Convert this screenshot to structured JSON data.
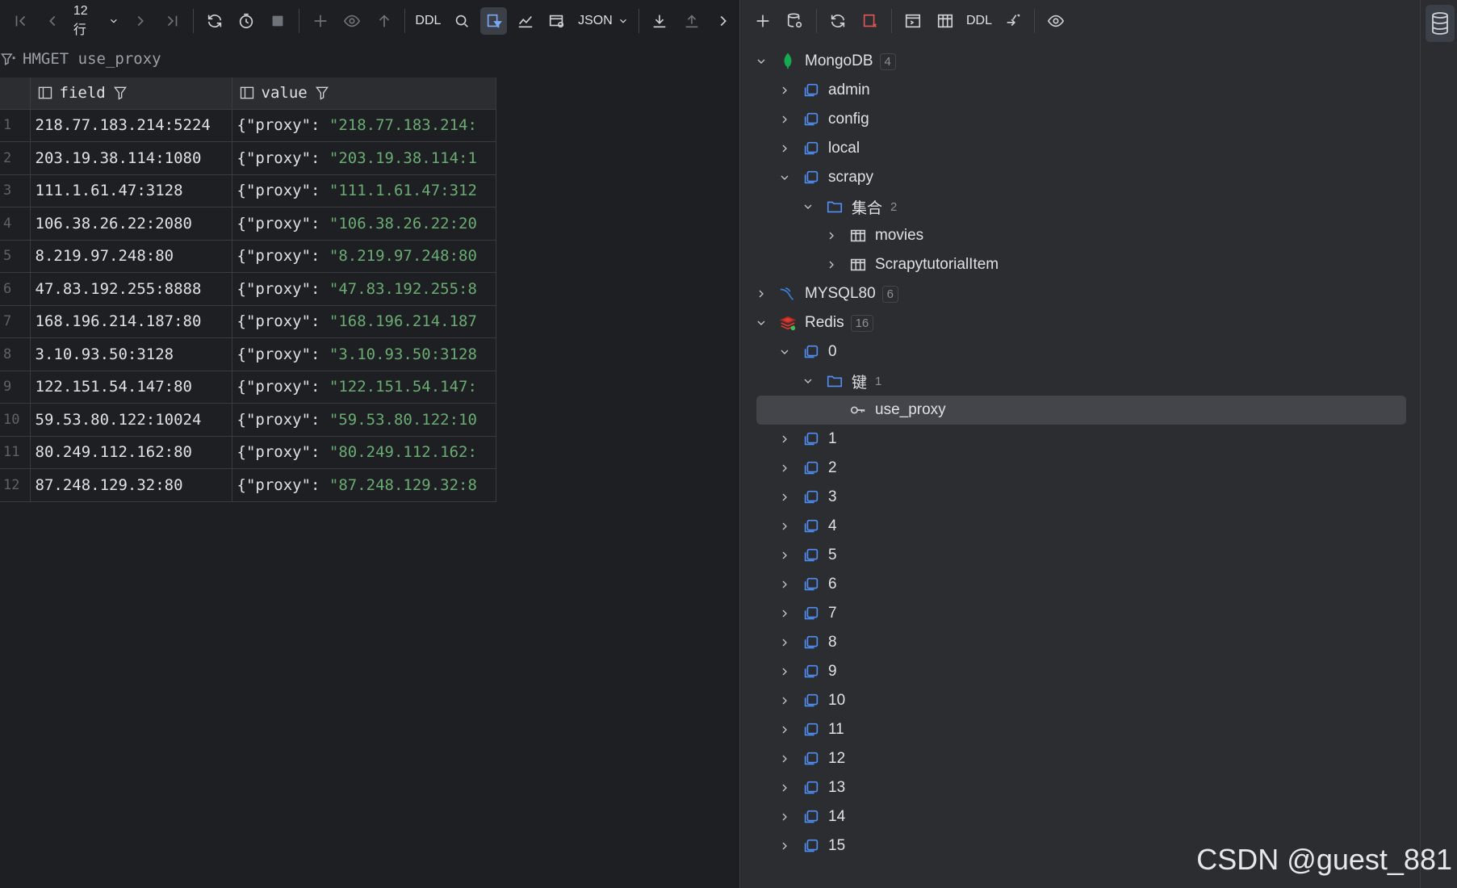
{
  "toolbar_left": {
    "rows_label": "12 行",
    "ddl_label": "DDL",
    "format_label": "JSON"
  },
  "toolbar_right": {
    "ddl_label": "DDL"
  },
  "query": {
    "text": "HMGET use_proxy"
  },
  "grid": {
    "headers": {
      "field": "field",
      "value": "value"
    },
    "rows": [
      {
        "n": "1",
        "field": "218.77.183.214:5224",
        "vkey": "{\"proxy\": ",
        "vstr": "\"218.77.183.214:"
      },
      {
        "n": "2",
        "field": "203.19.38.114:1080",
        "vkey": "{\"proxy\": ",
        "vstr": "\"203.19.38.114:1"
      },
      {
        "n": "3",
        "field": "111.1.61.47:3128",
        "vkey": "{\"proxy\": ",
        "vstr": "\"111.1.61.47:312"
      },
      {
        "n": "4",
        "field": "106.38.26.22:2080",
        "vkey": "{\"proxy\": ",
        "vstr": "\"106.38.26.22:20"
      },
      {
        "n": "5",
        "field": "8.219.97.248:80",
        "vkey": "{\"proxy\": ",
        "vstr": "\"8.219.97.248:80"
      },
      {
        "n": "6",
        "field": "47.83.192.255:8888",
        "vkey": "{\"proxy\": ",
        "vstr": "\"47.83.192.255:8"
      },
      {
        "n": "7",
        "field": "168.196.214.187:80",
        "vkey": "{\"proxy\": ",
        "vstr": "\"168.196.214.187"
      },
      {
        "n": "8",
        "field": "3.10.93.50:3128",
        "vkey": "{\"proxy\": ",
        "vstr": "\"3.10.93.50:3128"
      },
      {
        "n": "9",
        "field": "122.151.54.147:80",
        "vkey": "{\"proxy\": ",
        "vstr": "\"122.151.54.147:"
      },
      {
        "n": "10",
        "field": "59.53.80.122:10024",
        "vkey": "{\"proxy\": ",
        "vstr": "\"59.53.80.122:10"
      },
      {
        "n": "11",
        "field": "80.249.112.162:80",
        "vkey": "{\"proxy\": ",
        "vstr": "\"80.249.112.162:"
      },
      {
        "n": "12",
        "field": "87.248.129.32:80",
        "vkey": "{\"proxy\": ",
        "vstr": "\"87.248.129.32:8"
      }
    ]
  },
  "tree": [
    {
      "label": "MongoDB",
      "badge": "4",
      "level": 0,
      "expanded": true,
      "icon": "mongodb-icon"
    },
    {
      "label": "admin",
      "level": 1,
      "expanded": false,
      "icon": "database-icon"
    },
    {
      "label": "config",
      "level": 1,
      "expanded": false,
      "icon": "database-icon"
    },
    {
      "label": "local",
      "level": 1,
      "expanded": false,
      "icon": "database-icon"
    },
    {
      "label": "scrapy",
      "level": 1,
      "expanded": true,
      "icon": "database-icon"
    },
    {
      "label": "集合",
      "count": "2",
      "level": 2,
      "expanded": true,
      "icon": "folder-icon"
    },
    {
      "label": "movies",
      "level": 3,
      "expanded": false,
      "icon": "table-icon"
    },
    {
      "label": "ScrapytutorialItem",
      "level": 3,
      "expanded": false,
      "icon": "table-icon"
    },
    {
      "label": "MYSQL80",
      "badge": "6",
      "level": 0,
      "expanded": false,
      "icon": "mysql-icon"
    },
    {
      "label": "Redis",
      "badge": "16",
      "level": 0,
      "expanded": true,
      "icon": "redis-icon"
    },
    {
      "label": "0",
      "level": 1,
      "expanded": true,
      "icon": "database-icon"
    },
    {
      "label": "键",
      "count": "1",
      "level": 2,
      "expanded": true,
      "icon": "folder-icon"
    },
    {
      "label": "use_proxy",
      "level": 3,
      "leaf": true,
      "selected": true,
      "icon": "key-icon"
    },
    {
      "label": "1",
      "level": 1,
      "expanded": false,
      "icon": "database-icon"
    },
    {
      "label": "2",
      "level": 1,
      "expanded": false,
      "icon": "database-icon"
    },
    {
      "label": "3",
      "level": 1,
      "expanded": false,
      "icon": "database-icon"
    },
    {
      "label": "4",
      "level": 1,
      "expanded": false,
      "icon": "database-icon"
    },
    {
      "label": "5",
      "level": 1,
      "expanded": false,
      "icon": "database-icon"
    },
    {
      "label": "6",
      "level": 1,
      "expanded": false,
      "icon": "database-icon"
    },
    {
      "label": "7",
      "level": 1,
      "expanded": false,
      "icon": "database-icon"
    },
    {
      "label": "8",
      "level": 1,
      "expanded": false,
      "icon": "database-icon"
    },
    {
      "label": "9",
      "level": 1,
      "expanded": false,
      "icon": "database-icon"
    },
    {
      "label": "10",
      "level": 1,
      "expanded": false,
      "icon": "database-icon"
    },
    {
      "label": "11",
      "level": 1,
      "expanded": false,
      "icon": "database-icon"
    },
    {
      "label": "12",
      "level": 1,
      "expanded": false,
      "icon": "database-icon"
    },
    {
      "label": "13",
      "level": 1,
      "expanded": false,
      "icon": "database-icon"
    },
    {
      "label": "14",
      "level": 1,
      "expanded": false,
      "icon": "database-icon"
    },
    {
      "label": "15",
      "level": 1,
      "expanded": false,
      "icon": "database-icon"
    }
  ],
  "watermark": "CSDN @guest_881",
  "colors": {
    "background": "#1e1f22",
    "panel": "#2b2d30",
    "string": "#6aab73",
    "accent": "#4f8ff7"
  }
}
